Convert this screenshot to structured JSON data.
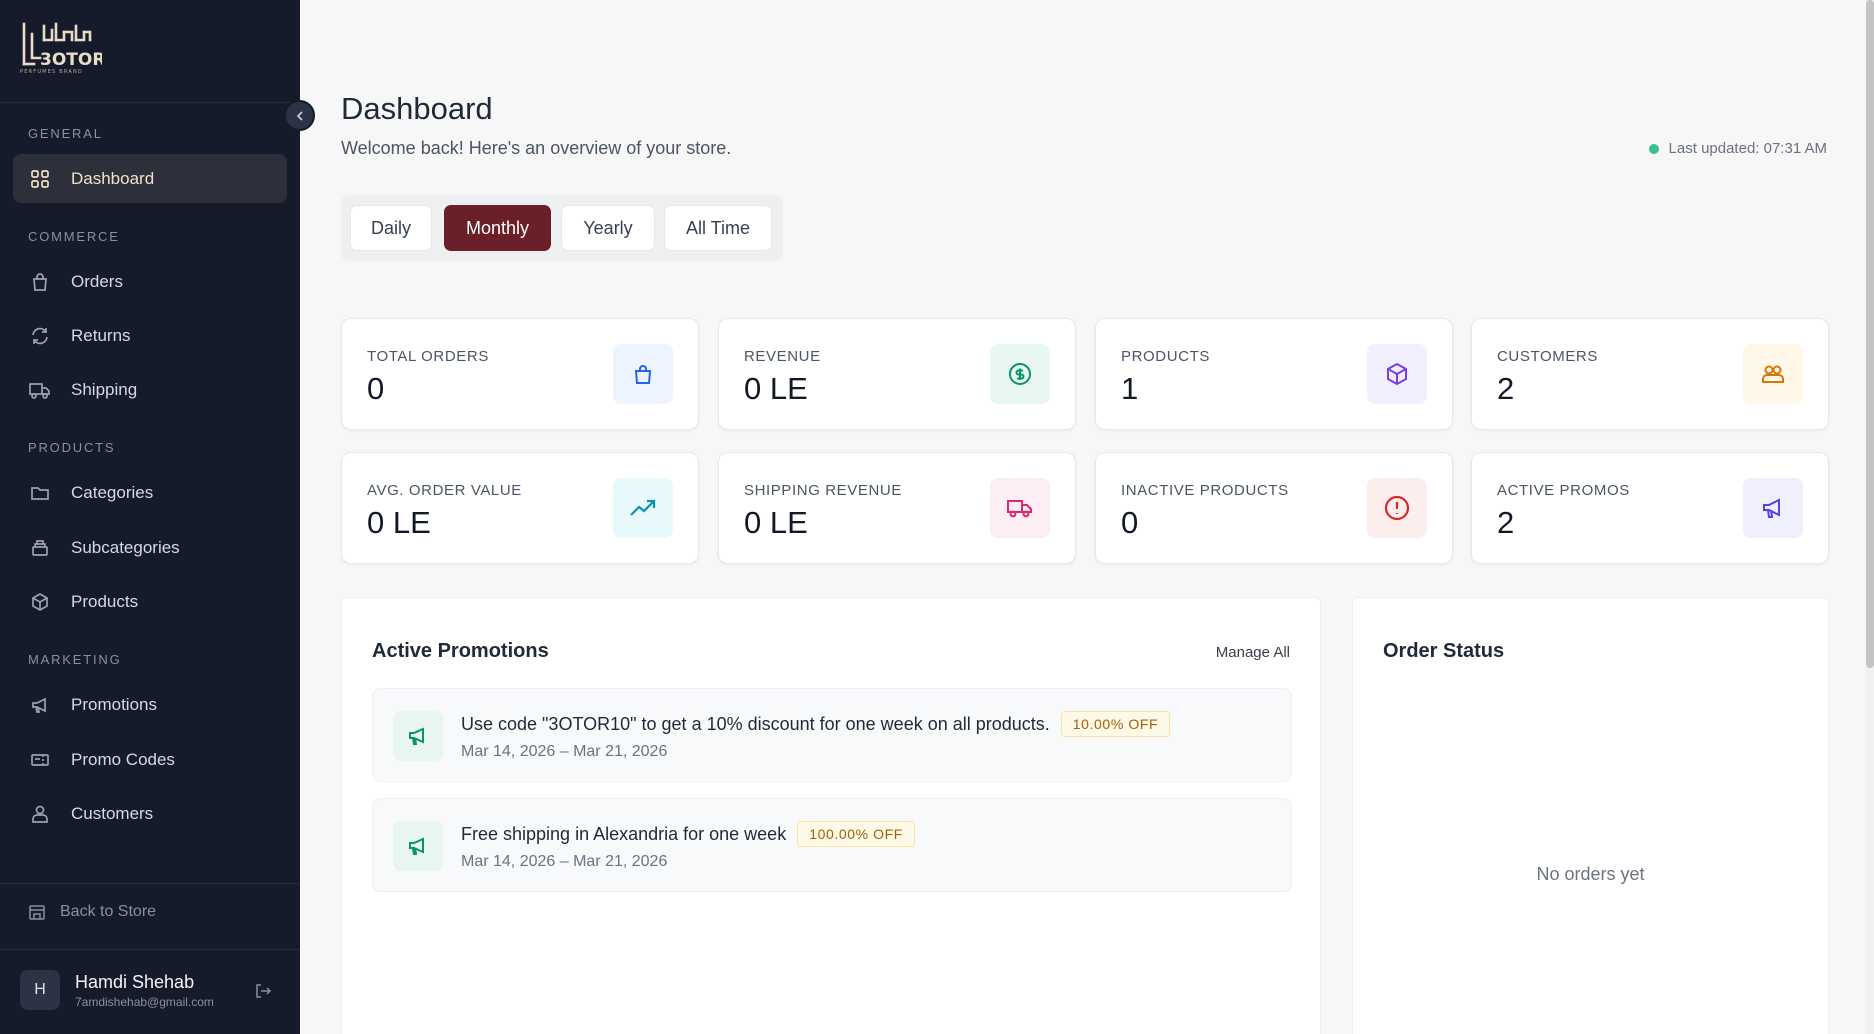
{
  "brand": {
    "logo_text": "3OTOR",
    "logo_tagline": "PERFUMES BRAND"
  },
  "sidebar": {
    "sections": [
      {
        "label": "GENERAL"
      },
      {
        "label": "COMMERCE"
      },
      {
        "label": "PRODUCTS"
      },
      {
        "label": "MARKETING"
      }
    ],
    "items": [
      {
        "label": "Dashboard",
        "icon": "grid-icon",
        "active": true
      },
      {
        "label": "Orders",
        "icon": "shopping-bag-icon"
      },
      {
        "label": "Returns",
        "icon": "refresh-icon"
      },
      {
        "label": "Shipping",
        "icon": "truck-icon"
      },
      {
        "label": "Categories",
        "icon": "folder-icon"
      },
      {
        "label": "Subcategories",
        "icon": "layers-icon"
      },
      {
        "label": "Products",
        "icon": "package-icon"
      },
      {
        "label": "Promotions",
        "icon": "megaphone-icon"
      },
      {
        "label": "Promo Codes",
        "icon": "ticket-icon"
      },
      {
        "label": "Customers",
        "icon": "users-icon"
      }
    ],
    "back_to_store": "Back to Store",
    "user": {
      "initial": "H",
      "name": "Hamdi Shehab",
      "email": "7amdishehab@gmail.com"
    }
  },
  "header": {
    "title": "Dashboard",
    "subtitle": "Welcome back! Here's an overview of your store.",
    "last_updated": "Last updated: 07:31 AM"
  },
  "period_tabs": [
    {
      "label": "Daily"
    },
    {
      "label": "Monthly",
      "active": true
    },
    {
      "label": "Yearly"
    },
    {
      "label": "All Time"
    }
  ],
  "stats": [
    {
      "label": "TOTAL ORDERS",
      "value": "0",
      "icon": "shopping-bag-icon",
      "color": "#2563eb",
      "bg": "#eef4ff"
    },
    {
      "label": "REVENUE",
      "value": "0 LE",
      "icon": "dollar-icon",
      "color": "#059669",
      "bg": "#e8f7f0"
    },
    {
      "label": "PRODUCTS",
      "value": "1",
      "icon": "package-icon",
      "color": "#7c3aed",
      "bg": "#f2efff"
    },
    {
      "label": "CUSTOMERS",
      "value": "2",
      "icon": "users-icon",
      "color": "#d97706",
      "bg": "#fff8e8"
    },
    {
      "label": "AVG. ORDER VALUE",
      "value": "0 LE",
      "icon": "trending-up-icon",
      "color": "#0891b2",
      "bg": "#e8f9fb"
    },
    {
      "label": "SHIPPING REVENUE",
      "value": "0 LE",
      "icon": "truck-icon",
      "color": "#db2777",
      "bg": "#fdeef4"
    },
    {
      "label": "INACTIVE PRODUCTS",
      "value": "0",
      "icon": "alert-circle-icon",
      "color": "#dc2626",
      "bg": "#fdeeee"
    },
    {
      "label": "ACTIVE PROMOS",
      "value": "2",
      "icon": "megaphone-icon",
      "color": "#4f46e5",
      "bg": "#efeffd"
    }
  ],
  "promotions_panel": {
    "title": "Active Promotions",
    "manage_all": "Manage All",
    "items": [
      {
        "text": "Use code \"3OTOR10\" to get a 10% discount for one week on all products.",
        "badge": "10.00% OFF",
        "dates": "Mar 14, 2026 – Mar 21, 2026"
      },
      {
        "text": "Free shipping in Alexandria for one week",
        "badge": "100.00% OFF",
        "dates": "Mar 14, 2026 – Mar 21, 2026"
      }
    ]
  },
  "order_status_panel": {
    "title": "Order Status",
    "empty_text": "No orders yet"
  },
  "colors": {
    "sidebar_bg": "#161b2c",
    "accent": "#6b1f28",
    "active_text": "#f1e2c7",
    "status_dot": "#34c38f"
  }
}
